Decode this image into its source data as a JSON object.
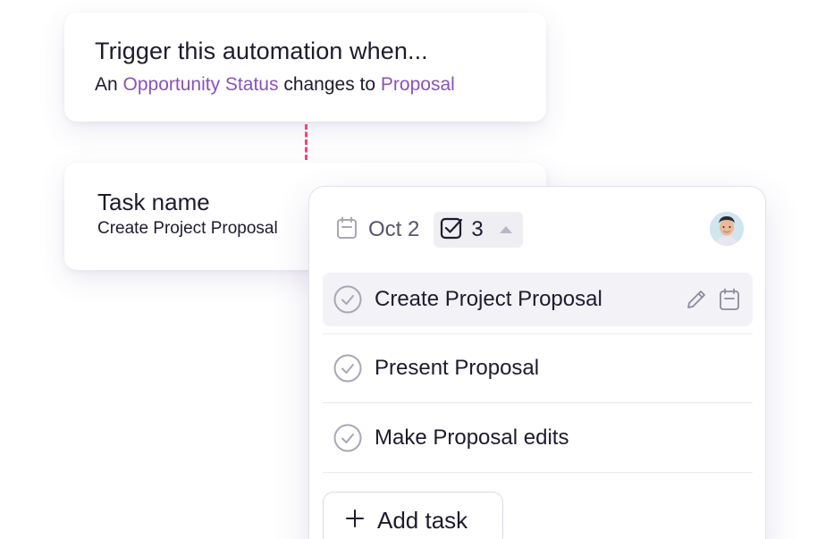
{
  "trigger": {
    "title": "Trigger this automation when...",
    "prefix": "An",
    "field": "Opportunity Status",
    "middle": "changes to",
    "value": "Proposal"
  },
  "task_name": {
    "label": "Task name",
    "value": "Create Project Proposal"
  },
  "panel": {
    "date": "Oct 2",
    "subtask_count": "3",
    "tasks": [
      {
        "label": "Create Project Proposal"
      },
      {
        "label": "Present Proposal"
      },
      {
        "label": "Make Proposal edits"
      }
    ],
    "add_task_label": "Add task"
  },
  "colors": {
    "accent": "#8a52b8",
    "connector": "#f0467a",
    "text": "#1e1b2e",
    "muted": "#57546a"
  },
  "icons": [
    "calendar-icon",
    "checkbox-icon",
    "caret-up-icon",
    "avatar",
    "check-circle-icon",
    "pencil-icon",
    "plus-icon"
  ]
}
